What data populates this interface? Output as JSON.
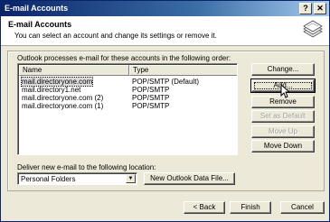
{
  "window": {
    "title": "E-mail Accounts",
    "help_label": "?",
    "close_label": "✕"
  },
  "header": {
    "title": "E-mail Accounts",
    "subtitle": "You can select an account and change its settings or remove it.",
    "icon": "envelope-stack-icon"
  },
  "accounts": {
    "instruction": "Outlook processes e-mail for these accounts in the following order:",
    "columns": [
      "Name",
      "Type"
    ],
    "rows": [
      {
        "name": "mail.directoryone.com",
        "type": "POP/SMTP (Default)",
        "selected": true
      },
      {
        "name": "mail.directory1.net",
        "type": "POP/SMTP",
        "selected": false
      },
      {
        "name": "mail.directoryone.com (2)",
        "type": "POP/SMTP",
        "selected": false
      },
      {
        "name": "mail.directoryone.com (1)",
        "type": "POP/SMTP",
        "selected": false
      }
    ]
  },
  "side_buttons": {
    "change": "Change...",
    "add": "Add...",
    "remove": "Remove",
    "set_default": "Set as Default",
    "move_up": "Move Up",
    "move_down": "Move Down"
  },
  "delivery": {
    "label": "Deliver new e-mail to the following location:",
    "selected": "Personal Folders",
    "new_file_button": "New Outlook Data File..."
  },
  "footer": {
    "back": "< Back",
    "finish": "Finish",
    "cancel": "Cancel"
  }
}
